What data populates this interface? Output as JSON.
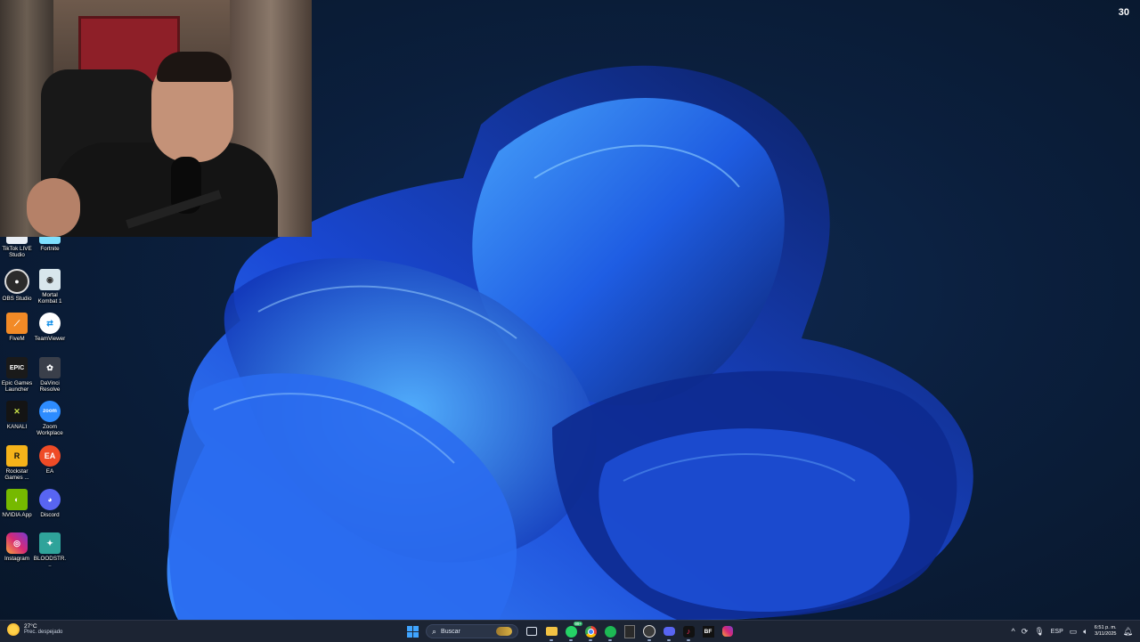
{
  "overlay": {
    "fps_counter": "30"
  },
  "desktop": {
    "icons": [
      {
        "label": "TikTok LIVE Studio",
        "icon": "tiktok-live-icon",
        "color": "#e9eef5"
      },
      {
        "label": "Fortnite",
        "icon": "fortnite-icon",
        "color": "#7ee0ff"
      },
      {
        "label": "OBS Studio",
        "icon": "obs-icon",
        "color": "#2b2b2b"
      },
      {
        "label": "Mortal Kombat 1",
        "icon": "mortal-kombat-icon",
        "color": "#d8e6ec"
      },
      {
        "label": "FiveM",
        "icon": "fivem-icon",
        "color": "#f28a26"
      },
      {
        "label": "TeamViewer",
        "icon": "teamviewer-icon",
        "color": "#0e8ee9"
      },
      {
        "label": "Epic Games Launcher",
        "icon": "epic-games-icon",
        "color": "#1a1a1a"
      },
      {
        "label": "DaVinci Resolve",
        "icon": "davinci-resolve-icon",
        "color": "#3a3f4a"
      },
      {
        "label": "KANALI",
        "icon": "kanali-icon",
        "color": "#141414"
      },
      {
        "label": "Zoom Workplace",
        "icon": "zoom-icon",
        "color": "#2d8cff"
      },
      {
        "label": "Rockstar Games ...",
        "icon": "rockstar-icon",
        "color": "#f5b31a"
      },
      {
        "label": "EA",
        "icon": "ea-icon",
        "color": "#ef4b26"
      },
      {
        "label": "NVIDIA App",
        "icon": "nvidia-icon",
        "color": "#76b900"
      },
      {
        "label": "Discord",
        "icon": "discord-icon",
        "color": "#5865f2"
      },
      {
        "label": "Instagram",
        "icon": "instagram-icon",
        "color": "#d62976"
      },
      {
        "label": "BLOODSTR...",
        "icon": "bloodstrike-icon",
        "color": "#2fa39a"
      }
    ]
  },
  "taskbar": {
    "weather": {
      "temp": "27°C",
      "desc": "Prec. despejado"
    },
    "search_placeholder": "Buscar",
    "apps": [
      {
        "name": "file-explorer-icon",
        "color": "#f3c344"
      },
      {
        "name": "whatsapp-icon",
        "color": "#25d366",
        "badge": "99+"
      },
      {
        "name": "chrome-icon",
        "color": "#e94235"
      },
      {
        "name": "spotify-icon",
        "color": "#1db954"
      },
      {
        "name": "epic-games-icon",
        "color": "#2a2a2a"
      },
      {
        "name": "obs-icon",
        "color": "#3b3b3b"
      },
      {
        "name": "discord-icon",
        "color": "#5865f2"
      },
      {
        "name": "tiktok-icon",
        "color": "#111111"
      },
      {
        "name": "bf-icon",
        "color": "#111111",
        "text": "BF"
      },
      {
        "name": "instagram-icon",
        "color": "#d62976"
      }
    ],
    "tray": {
      "language": "ESP",
      "time": "6:51 p. m.",
      "date": "3/11/2025"
    }
  },
  "colors": {
    "accent": "#3fa4ff",
    "taskbar_bg": "#1c2433"
  }
}
